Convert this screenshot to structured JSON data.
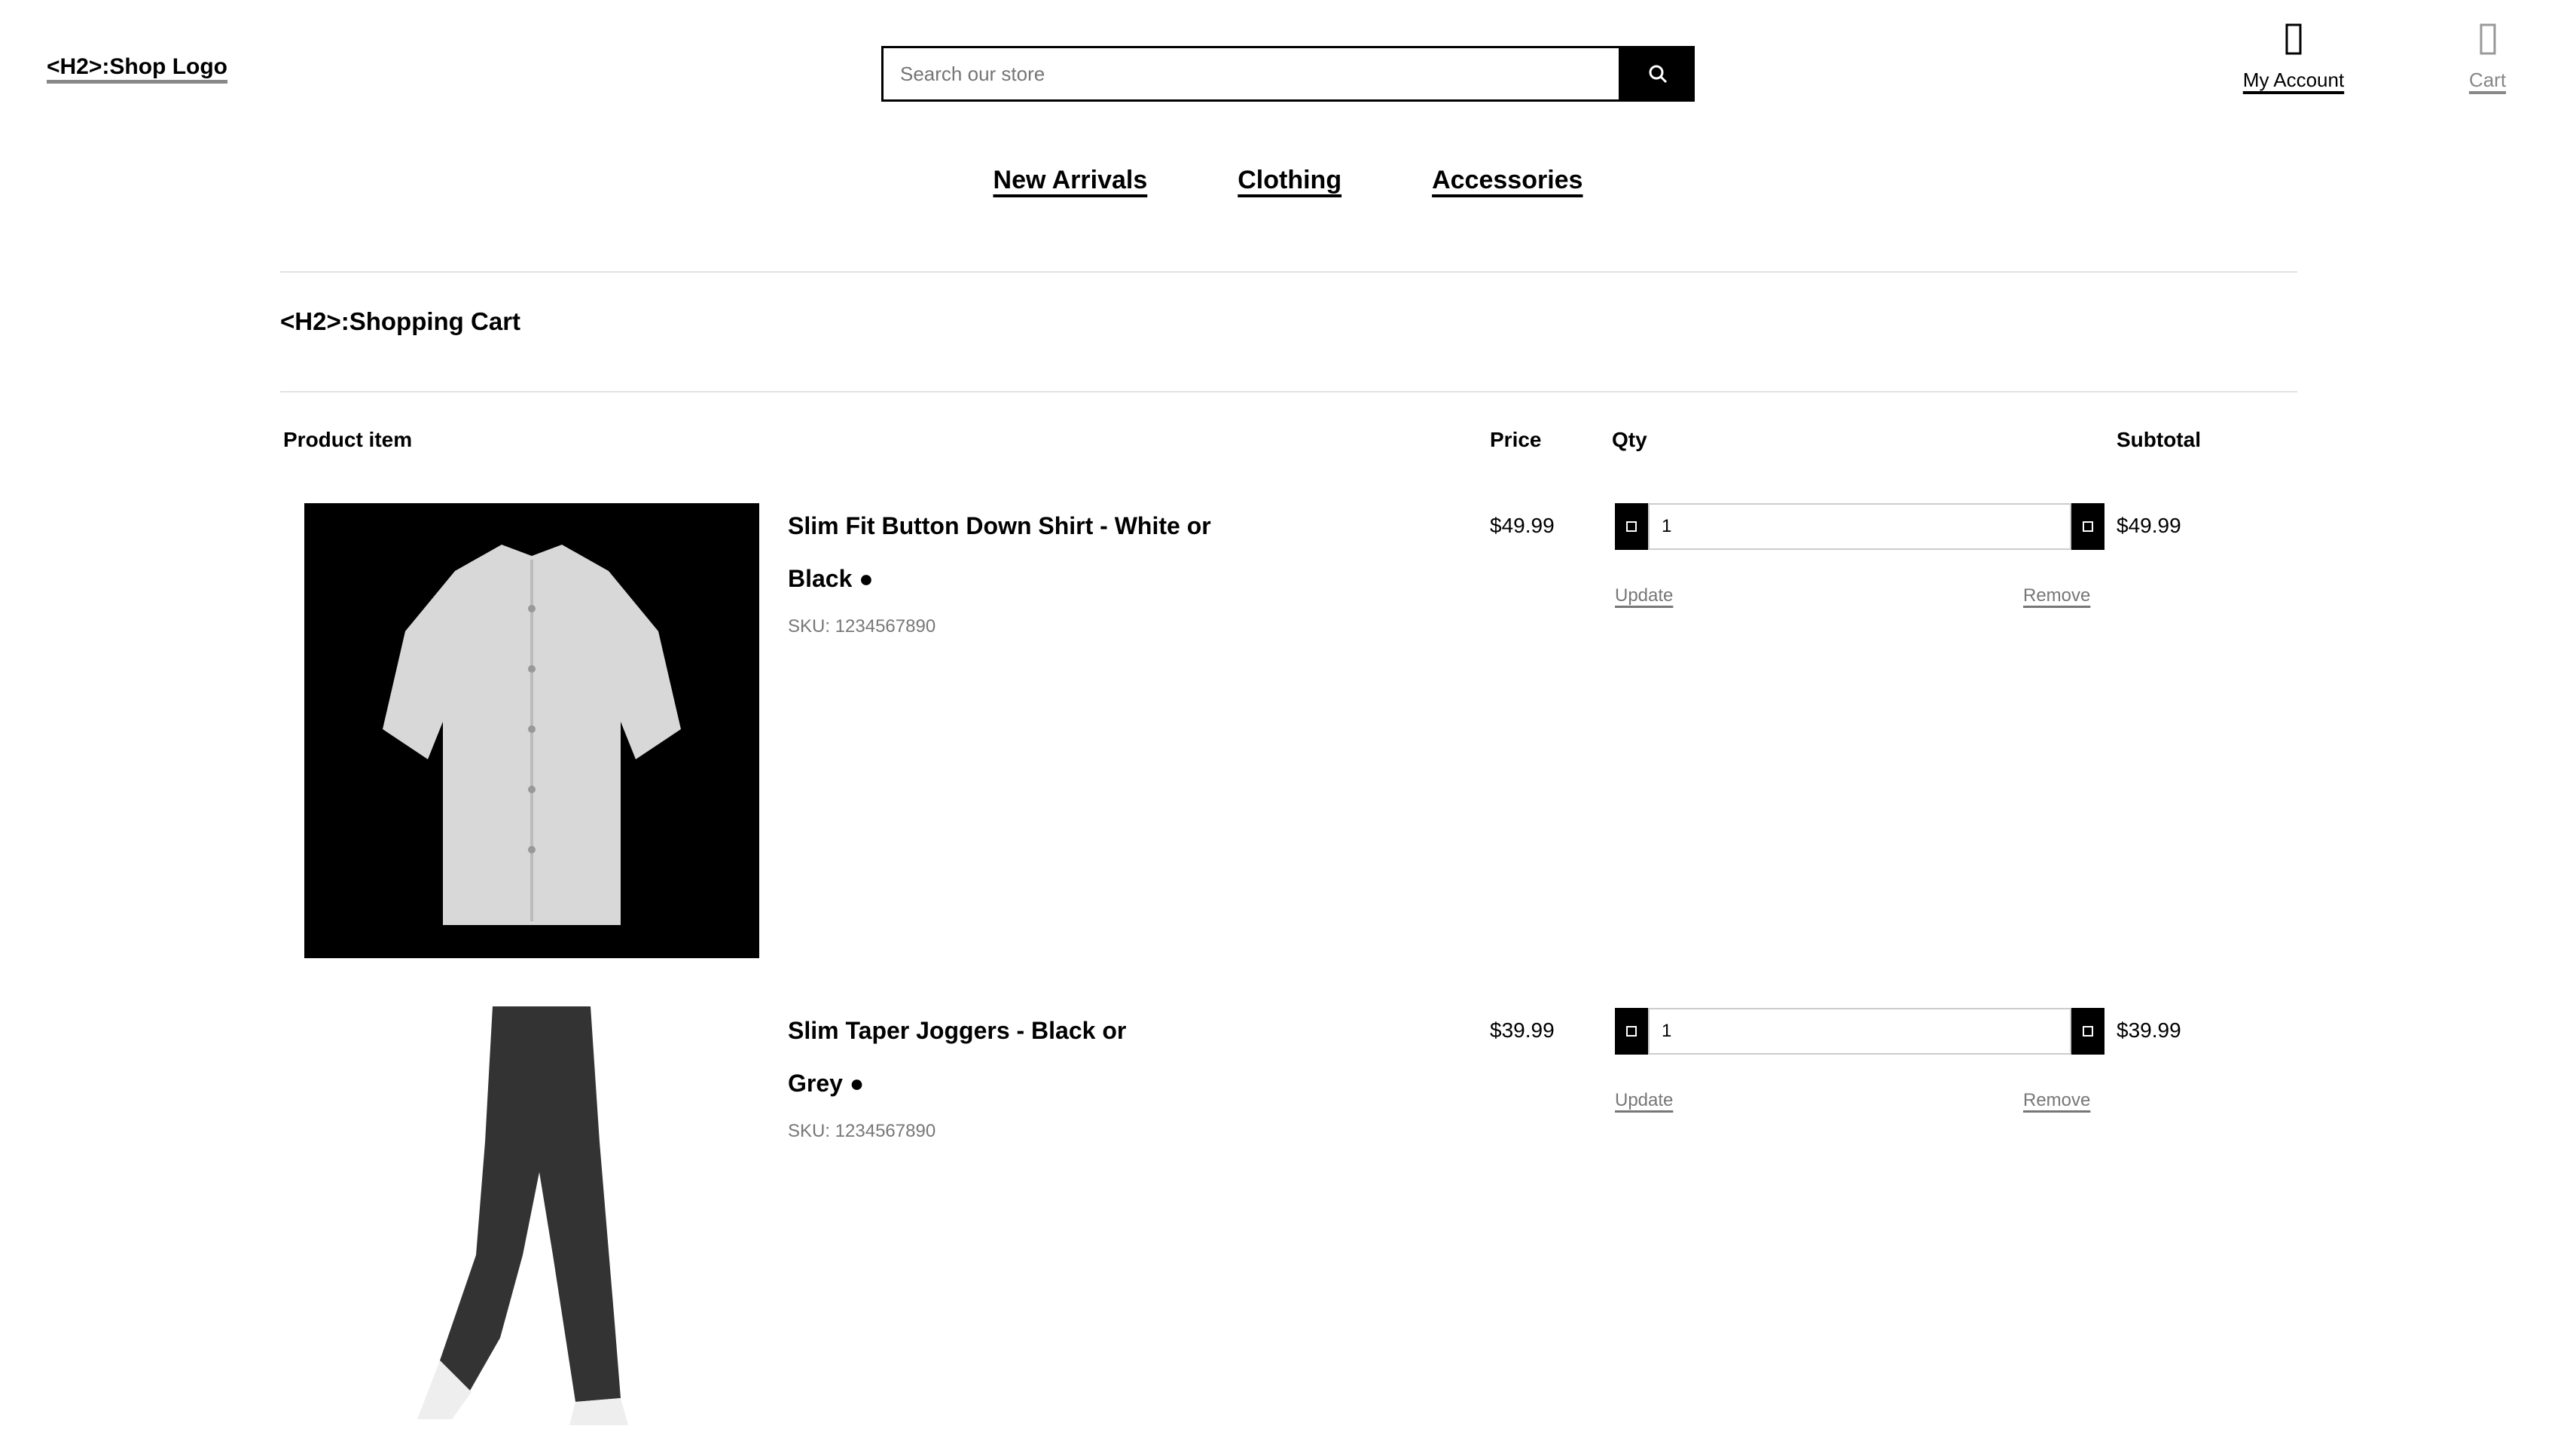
{
  "header": {
    "title": "<H2>:Shop Logo",
    "search": {
      "placeholder": "Search our store",
      "button_icon": "search-icon"
    },
    "links": [
      {
        "icon": "user-icon",
        "glyph": "👤",
        "label": "My Account"
      },
      {
        "icon": "cart-icon",
        "glyph": "🛒",
        "label": "Cart"
      }
    ]
  },
  "nav": {
    "items": [
      "New Arrivals",
      "Clothing",
      "Accessories"
    ]
  },
  "page": {
    "title": "<H2>:Shopping Cart"
  },
  "cart": {
    "columns": {
      "product": "Product item",
      "price": "Price",
      "qty": "Qty",
      "subtotal": "Subtotal"
    },
    "items": [
      {
        "name": "Slim Fit Button Down Shirt - White or",
        "name2": "Black ●",
        "meta": "SKU: 1234567890",
        "price": "$49.99",
        "qty": "1",
        "update": "Update",
        "remove": "Remove",
        "subtotal": "$49.99"
      },
      {
        "name": "Slim Taper Joggers - Black or",
        "name2": "Grey ●",
        "meta": "SKU: 1234567890",
        "price": "$39.99",
        "qty": "1",
        "update": "Update",
        "remove": "Remove",
        "subtotal": "$39.99"
      }
    ]
  }
}
